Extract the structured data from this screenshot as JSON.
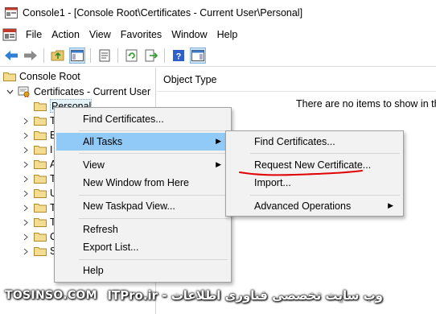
{
  "window": {
    "title": "Console1 - [Console Root\\Certificates - Current User\\Personal]"
  },
  "menubar": {
    "items": [
      "File",
      "Action",
      "View",
      "Favorites",
      "Window",
      "Help"
    ]
  },
  "toolbar": {
    "icons": [
      "back-arrow-icon",
      "forward-arrow-icon",
      "up-folder-icon",
      "show-hide-tree-icon",
      "properties-icon",
      "refresh-icon",
      "export-list-icon",
      "help-icon",
      "show-hide-action-pane-icon"
    ]
  },
  "tree": {
    "root": "Console Root",
    "certificates": "Certificates - Current User",
    "personal": "Personal",
    "partial_children": [
      "T",
      "E",
      "I",
      "A",
      "T",
      "U",
      "T",
      "T",
      "C",
      "S"
    ]
  },
  "details": {
    "column_header": "Object Type",
    "empty_message": "There are no items to show in thi"
  },
  "context_menu": {
    "find_certificates": "Find Certificates...",
    "all_tasks": "All Tasks",
    "view": "View",
    "new_window": "New Window from Here",
    "new_taskpad": "New Taskpad View...",
    "refresh": "Refresh",
    "export_list": "Export List...",
    "help": "Help"
  },
  "submenu": {
    "find_certificates": "Find Certificates...",
    "request_new_certificate": "Request New Certificate...",
    "import": "Import...",
    "advanced_operations": "Advanced Operations"
  },
  "watermark": {
    "left": "TOSINSO.COM",
    "right": "وب سایت تخصصی فناوری اطلاعات - ITPro.ir"
  },
  "colors": {
    "highlight": "#91c9f7",
    "menu_bg": "#f2f2f2",
    "underline": "#e00000",
    "folder": "#e8c66a"
  }
}
